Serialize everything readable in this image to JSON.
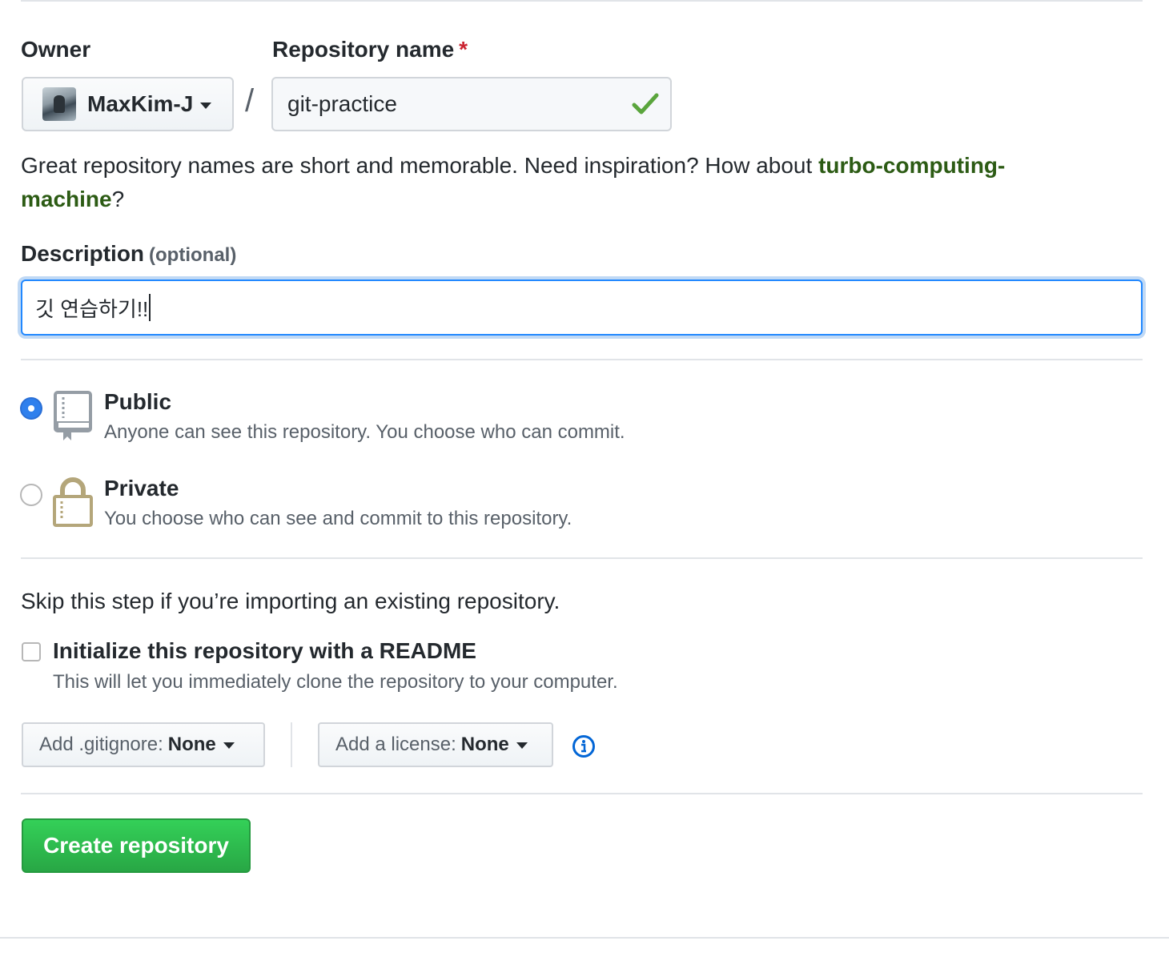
{
  "owner": {
    "label": "Owner",
    "name": "MaxKim-J"
  },
  "repository": {
    "label": "Repository name",
    "required_mark": "*",
    "separator": "/",
    "value": "git-practice"
  },
  "name_note": {
    "text_before": "Great repository names are short and memorable. Need inspiration? How about ",
    "suggestion": "turbo-computing-machine",
    "text_after": "?"
  },
  "description": {
    "label": "Description",
    "optional": "(optional)",
    "value": "깃 연습하기!!"
  },
  "visibility": {
    "public": {
      "title": "Public",
      "description": "Anyone can see this repository. You choose who can commit.",
      "selected": true,
      "icon": "repo-book-icon"
    },
    "private": {
      "title": "Private",
      "description": "You choose who can see and commit to this repository.",
      "selected": false,
      "icon": "lock-icon"
    }
  },
  "initialize": {
    "skip_note": "Skip this step if you’re importing an existing repository.",
    "readme_title": "Initialize this repository with a README",
    "readme_desc": "This will let you immediately clone the repository to your computer.",
    "checked": false
  },
  "gitignore": {
    "prefix": "Add .gitignore:",
    "value": "None"
  },
  "license": {
    "prefix": "Add a license:",
    "value": "None"
  },
  "create_button": "Create repository",
  "colors": {
    "primary_green": "#28a745",
    "suggestion_green": "#2c5b14",
    "focus_blue": "#2188ff",
    "required_red": "#cb2431",
    "check_green": "#5aa53c"
  }
}
